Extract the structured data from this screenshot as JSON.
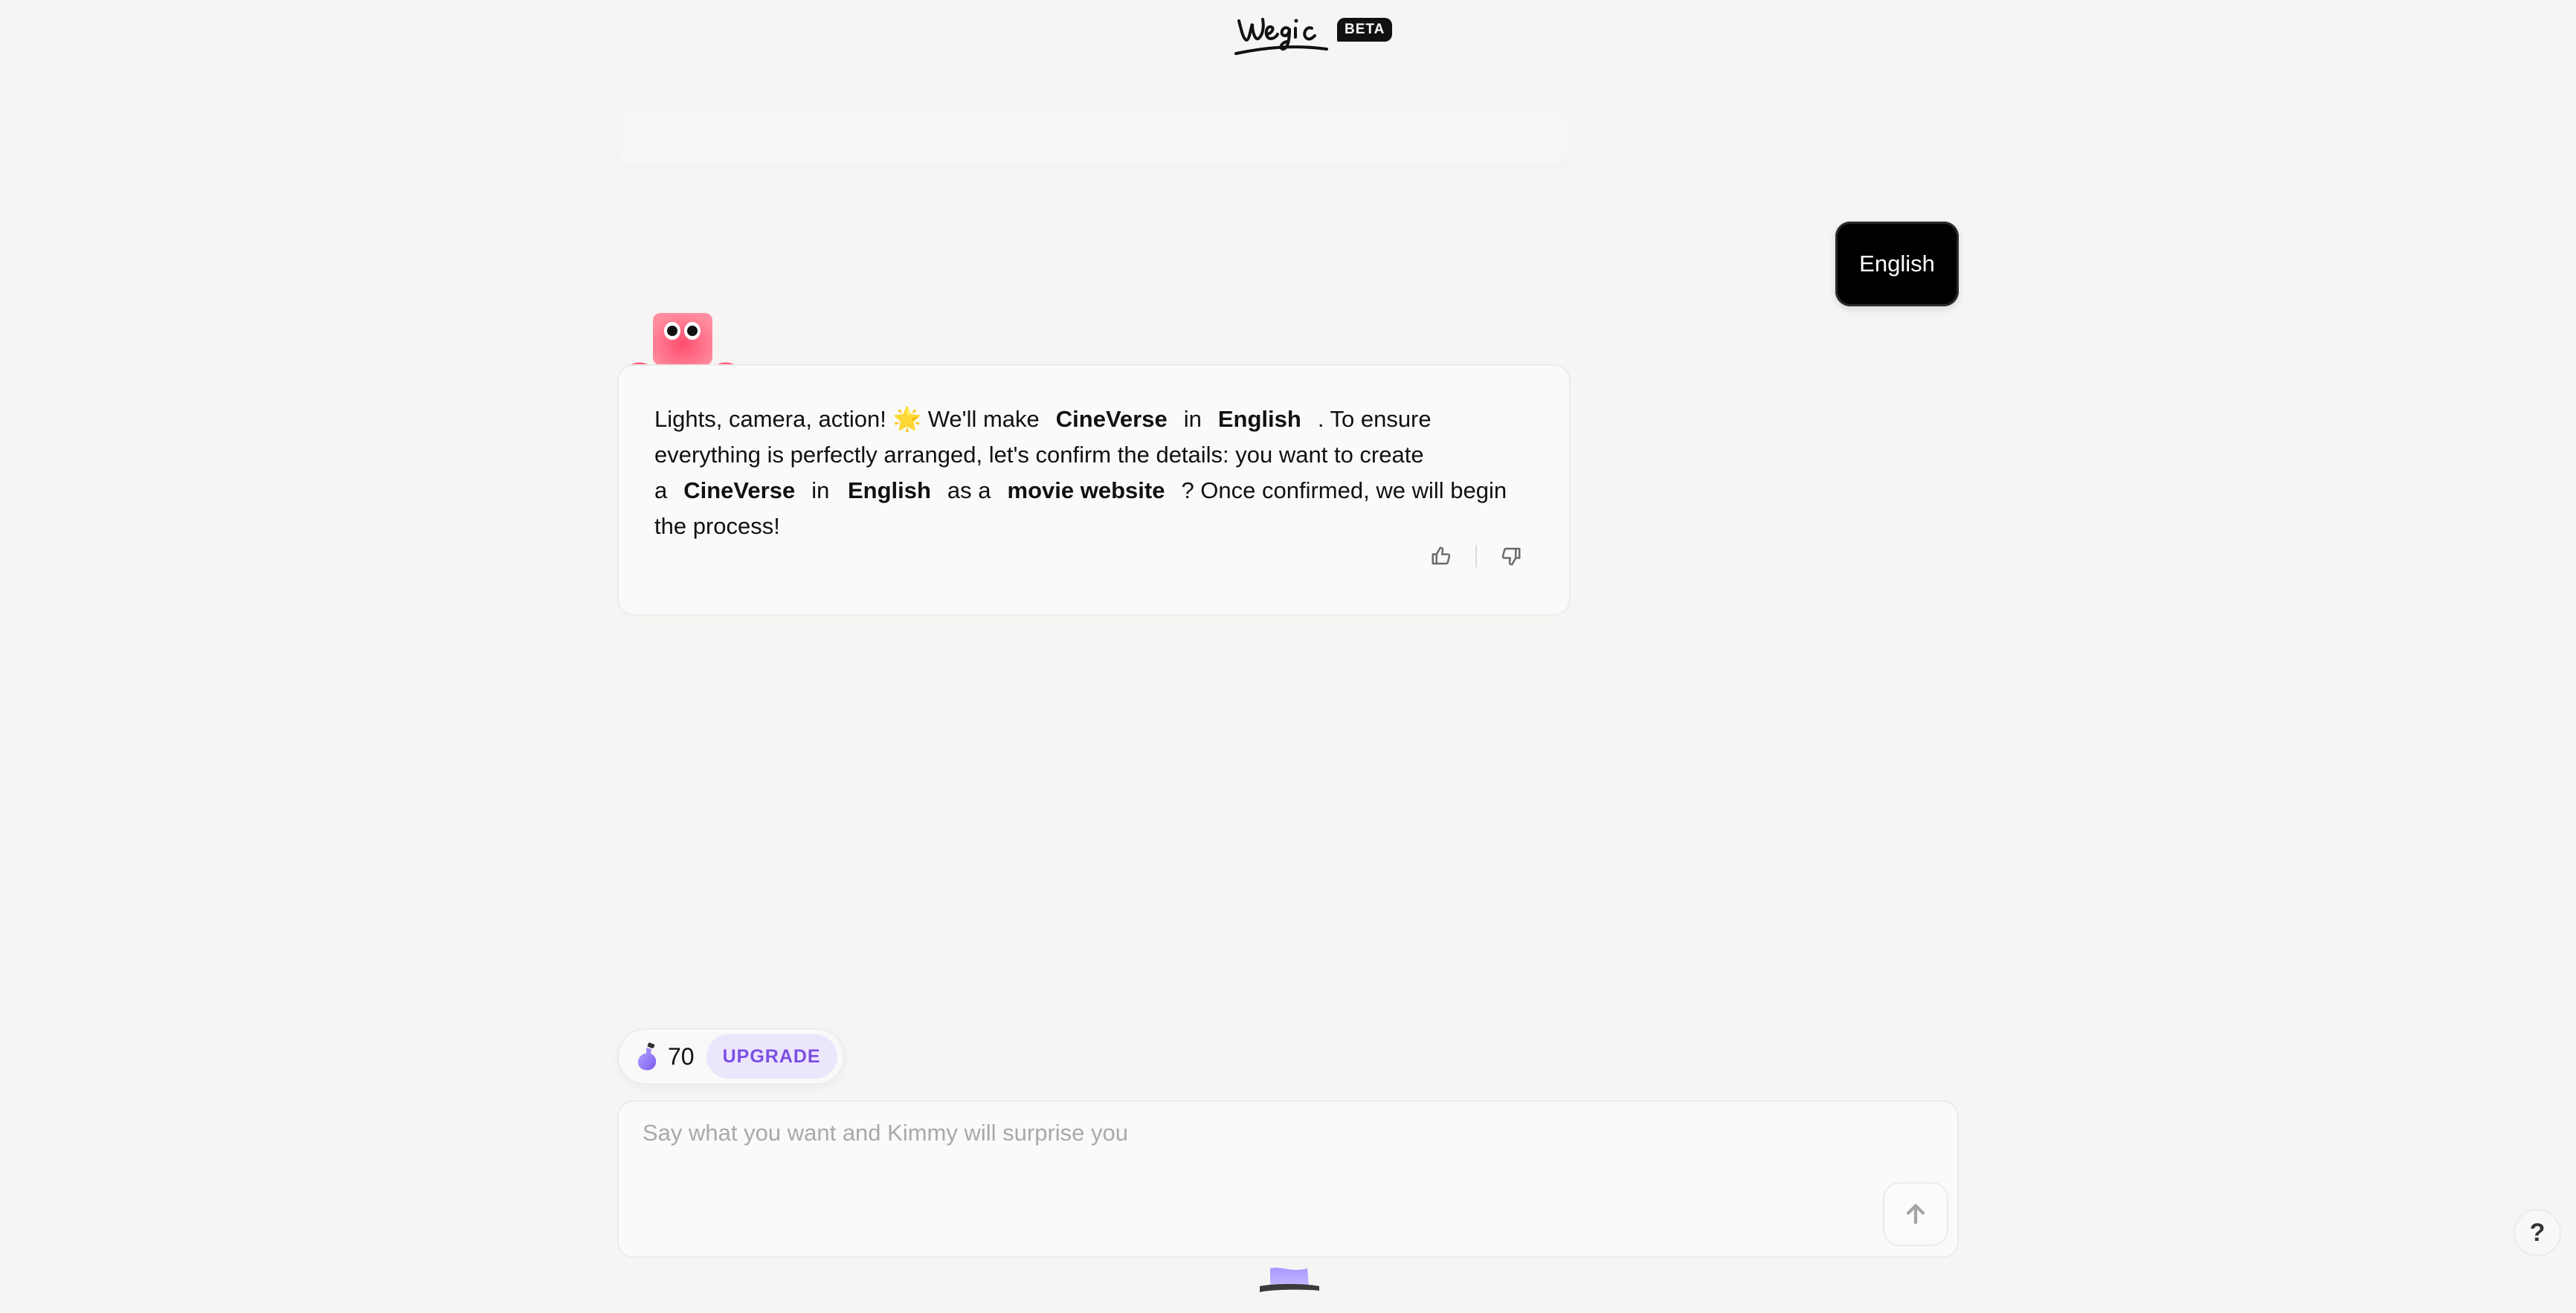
{
  "header": {
    "logo_text": "wegic",
    "badge": "BETA"
  },
  "chat": {
    "user_message": "English",
    "assistant": {
      "mascot_icon": "pink-robot-mascot",
      "segments": {
        "t1": "Lights, camera, action! ",
        "emoji": "🌟",
        "t2": " We'll make",
        "b1": "CineVerse",
        "t3": "in",
        "b2": "English",
        "t4": ". To ensure everything is perfectly arranged, let's confirm the details: you want to create a",
        "b3": "CineVerse",
        "t5": "in",
        "b4": "English",
        "t6": "as a",
        "b5": "movie website",
        "t7": "? Once confirmed, we will begin the process!"
      },
      "feedback": {
        "like_icon": "thumbs-up-icon",
        "dislike_icon": "thumbs-down-icon"
      }
    }
  },
  "credits": {
    "icon": "potion-bottle-icon",
    "count": "70",
    "upgrade_label": "UPGRADE"
  },
  "composer": {
    "placeholder": "Say what you want and Kimmy will surprise you",
    "value": "",
    "send_icon": "arrow-up-icon"
  },
  "help": {
    "label": "?"
  },
  "colors": {
    "background": "#f6f5f3",
    "accent_purple": "#7c4ee4",
    "upgrade_bg": "#ece6fd",
    "user_bubble": "#000000"
  }
}
